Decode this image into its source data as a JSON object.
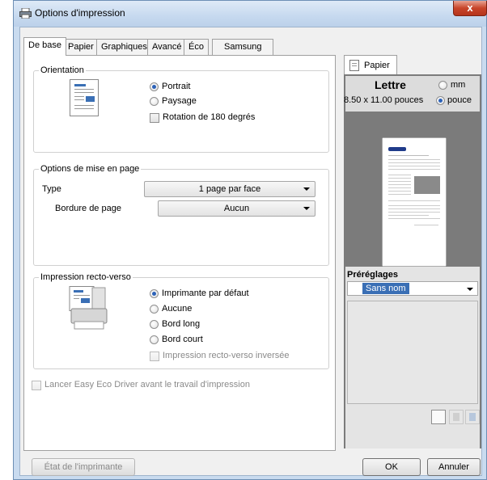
{
  "window": {
    "title": "Options d'impression",
    "close_glyph": "x"
  },
  "tabs": [
    "De base",
    "Papier",
    "Graphiques",
    "Avancé",
    "Éco",
    "Samsung"
  ],
  "orientation": {
    "title": "Orientation",
    "options": [
      "Portrait",
      "Paysage"
    ],
    "rotate_label": "Rotation de 180 degrés"
  },
  "layout": {
    "title": "Options de mise en page",
    "type_label": "Type",
    "type_value": "1 page par face",
    "border_label": "Bordure de page",
    "border_value": "Aucun"
  },
  "duplex": {
    "title": "Impression recto-verso",
    "options": [
      "Imprimante par défaut",
      "Aucune",
      "Bord long",
      "Bord court"
    ],
    "reverse_label": "Impression recto-verso inversée"
  },
  "eco_driver_label": "Lancer Easy Eco Driver avant le travail d'impression",
  "paper_panel": {
    "tab_label": "Papier",
    "size_name": "Lettre",
    "unit_mm": "mm",
    "size_dims": "8.50 x 11.00 pouces",
    "unit_inch": "pouce"
  },
  "presets": {
    "title": "Préréglages",
    "value": "Sans nom"
  },
  "brand": "SAMSUNG",
  "buttons": {
    "printer_status": "État de l'imprimante",
    "ok": "OK",
    "cancel": "Annuler"
  },
  "colors": {
    "accent": "#2c62b8",
    "panel_dark": "#7b7b7b",
    "title_bar": "#c6d9ef"
  }
}
